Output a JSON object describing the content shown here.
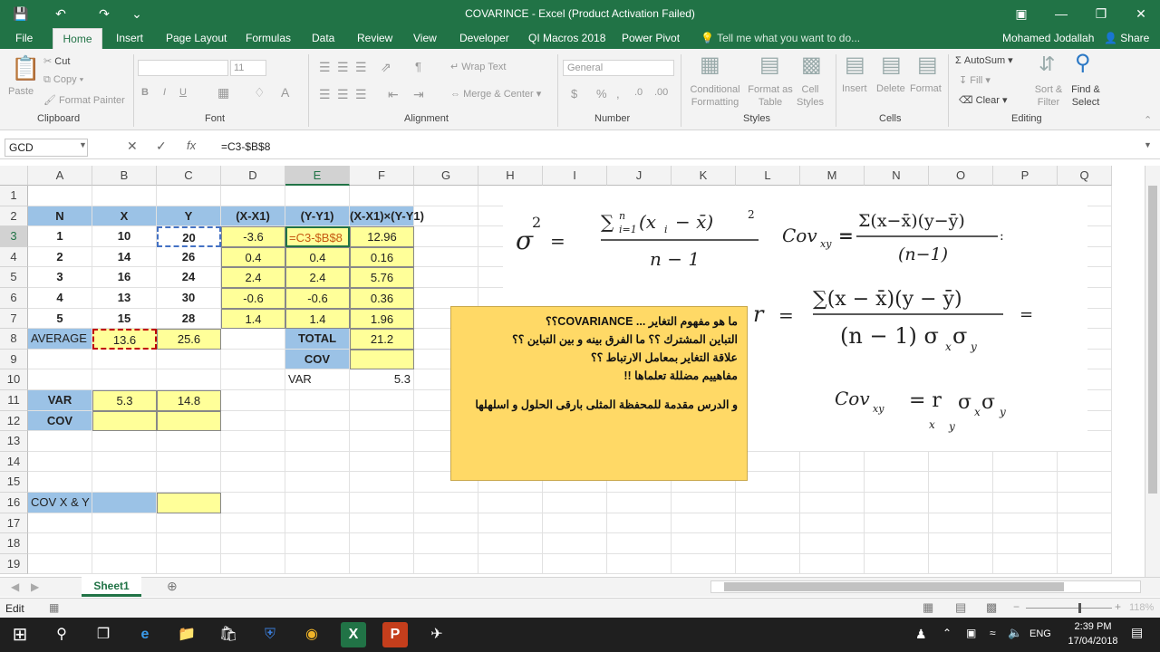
{
  "window": {
    "title": "COVARINCE - Excel (Product Activation Failed)"
  },
  "tabs": [
    "File",
    "Home",
    "Insert",
    "Page Layout",
    "Formulas",
    "Data",
    "Review",
    "View",
    "Developer",
    "QI Macros 2018",
    "Power Pivot"
  ],
  "tellme": "Tell me what you want to do...",
  "user": "Mohamed Jodallah",
  "share": "Share",
  "ribbon": {
    "clipboard": {
      "paste": "Paste",
      "cut": "Cut",
      "copy": "Copy",
      "format_painter": "Format Painter",
      "label": "Clipboard"
    },
    "font": {
      "size": "11",
      "label": "Font"
    },
    "alignment": {
      "wrap": "Wrap Text",
      "merge": "Merge & Center",
      "label": "Alignment"
    },
    "number": {
      "format": "General",
      "label": "Number"
    },
    "styles": {
      "cond": "Conditional Formatting",
      "format_table": "Format as Table",
      "cell_styles": "Cell Styles",
      "label": "Styles"
    },
    "cells": {
      "insert": "Insert",
      "delete": "Delete",
      "format": "Format",
      "label": "Cells"
    },
    "editing": {
      "autosum": "AutoSum",
      "fill": "Fill",
      "clear": "Clear",
      "sort": "Sort & Filter",
      "find": "Find & Select",
      "label": "Editing"
    }
  },
  "formula_bar": {
    "name_box": "GCD",
    "formula": "=C3-$B$8"
  },
  "columns": [
    "A",
    "B",
    "C",
    "D",
    "E",
    "F",
    "G",
    "H",
    "I",
    "J",
    "K",
    "L",
    "M",
    "N",
    "O",
    "P",
    "Q"
  ],
  "rows": [
    "1",
    "2",
    "3",
    "4",
    "5",
    "6",
    "7",
    "8",
    "9",
    "10",
    "11",
    "12",
    "13",
    "14",
    "15",
    "16",
    "17",
    "18",
    "19"
  ],
  "cells": {
    "A2": "N",
    "B2": "X",
    "C2": "Y",
    "D2": "(X-X1)",
    "E2": "(Y-Y1)",
    "F2": "(X-X1)×(Y-Y1)",
    "A3": "1",
    "B3": "10",
    "C3": "20",
    "D3": "-3.6",
    "E3": "=C3-$B$8",
    "F3": "12.96",
    "A4": "2",
    "B4": "14",
    "C4": "26",
    "D4": "0.4",
    "E4": "0.4",
    "F4": "0.16",
    "A5": "3",
    "B5": "16",
    "C5": "24",
    "D5": "2.4",
    "E5": "2.4",
    "F5": "5.76",
    "A6": "4",
    "B6": "13",
    "C6": "30",
    "D6": "-0.6",
    "E6": "-0.6",
    "F6": "0.36",
    "A7": "5",
    "B7": "15",
    "C7": "28",
    "D7": "1.4",
    "E7": "1.4",
    "F7": "1.96",
    "A8": "AVERAGE",
    "B8": "13.6",
    "C8": "25.6",
    "E8": "TOTAL",
    "F8": "21.2",
    "E9": "COV",
    "E10": "VAR",
    "F10": "5.3",
    "A11": "VAR",
    "B11": "5.3",
    "C11": "14.8",
    "A12": "COV",
    "A16": "COV X & Y"
  },
  "note": [
    "ما هو مفهوم التغاير ... COVARIANCE؟؟",
    "التباين المشترك ؟؟ ما الفرق بينه و بين التباين ؟؟",
    "علاقة التغاير بمعامل الارتباط ؟؟",
    "مفاهييم مضللة تعلماها !!",
    "",
    "و الدرس مقدمة للمحفظة المثلى بارقى الحلول و اسلهلها"
  ],
  "sheet": {
    "name": "Sheet1"
  },
  "status": {
    "mode": "Edit",
    "zoom": "118%"
  },
  "taskbar": {
    "time": "2:39 PM",
    "date": "17/04/2018",
    "lang": "ENG"
  },
  "colors": {
    "excel_green": "#217346",
    "header_blue": "#9bc2e6",
    "yellow": "#ffff99",
    "note": "#ffd966"
  }
}
